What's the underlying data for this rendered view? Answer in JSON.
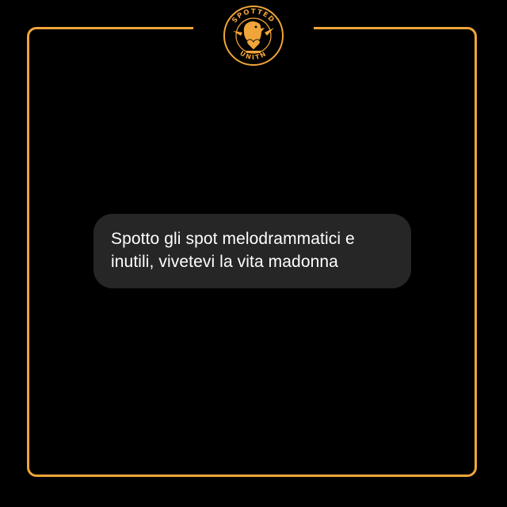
{
  "colors": {
    "background": "#000000",
    "accent": "#f0a53a",
    "bubble": "#262626",
    "text": "#ffffff"
  },
  "logo": {
    "icon": "spotted-unitn-eagle-heart-logo",
    "top_text": "SPOTTED",
    "bottom_text": "UNITN"
  },
  "message": {
    "lines": [
      "Spotto gli spot melodrammatici e",
      "inutili, vivetevi la vita madonna"
    ]
  }
}
